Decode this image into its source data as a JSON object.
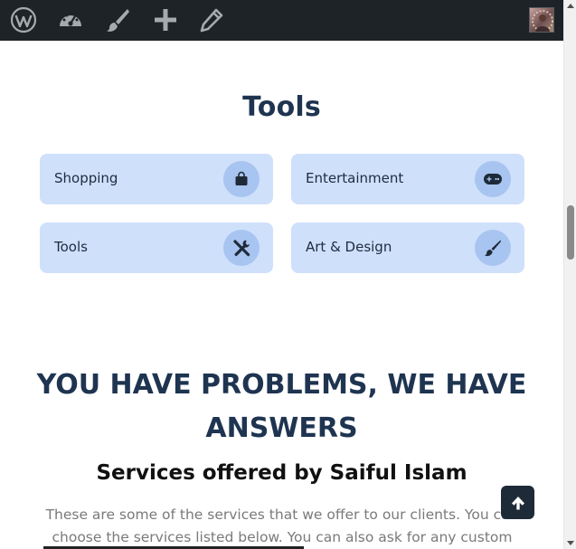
{
  "admin_bar": {
    "icons": [
      "wordpress-icon",
      "dashboard-icon",
      "brush-icon",
      "plus-icon",
      "pencil-icon"
    ],
    "avatar": "user-avatar"
  },
  "tools_section": {
    "title": "Tools",
    "cards": [
      {
        "label": "Shopping",
        "icon": "shopping-bag-icon"
      },
      {
        "label": "Entertainment",
        "icon": "gamepad-icon"
      },
      {
        "label": "Tools",
        "icon": "tools-icon"
      },
      {
        "label": "Art & Design",
        "icon": "paint-brush-icon"
      }
    ]
  },
  "services_section": {
    "headline": "YOU HAVE PROBLEMS, WE HAVE ANSWERS",
    "subheading": "Services offered by Saiful Islam",
    "description": "These are some of the services that we offer to our clients. You can choose the services listed below. You can also ask for any custom"
  },
  "back_to_top": {
    "icon": "arrow-up-icon"
  },
  "colors": {
    "admin_bar": "#1d2327",
    "heading": "#1e3450",
    "card_bg": "#cfe0fb",
    "card_icon_bg": "#a8c4f0",
    "back_to_top_bg": "#1e2a38"
  }
}
